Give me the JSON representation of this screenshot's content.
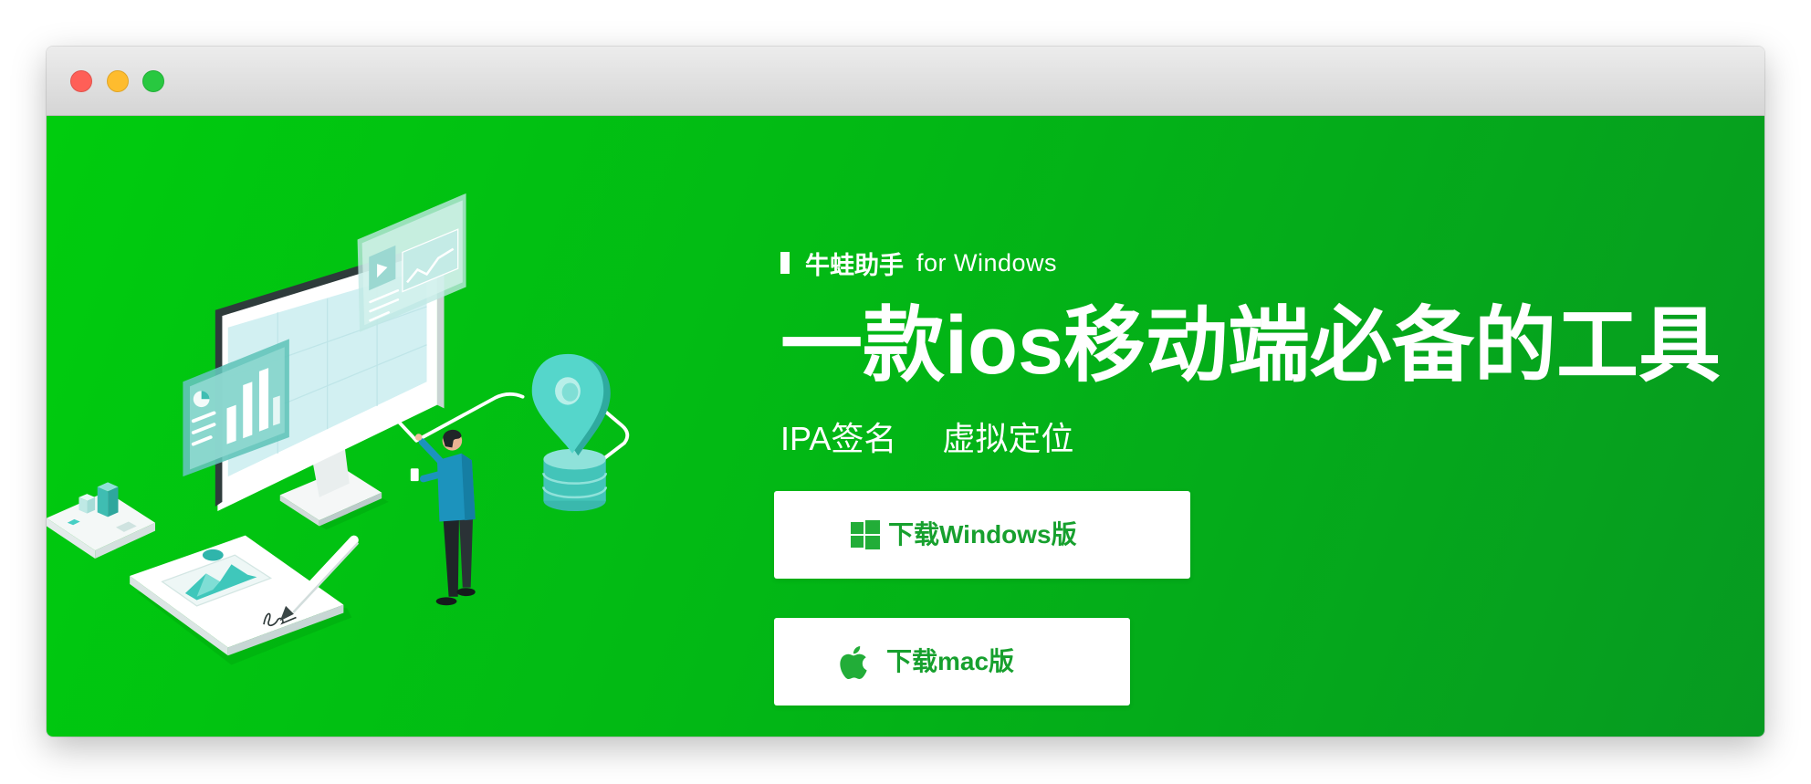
{
  "window": {
    "controls": {
      "close": "#ff5f57",
      "minimize": "#febc2e",
      "zoom": "#28c840"
    }
  },
  "hero": {
    "product_name": "牛蛙助手",
    "platform": "for Windows",
    "headline": "一款ios移动端必备的工具",
    "features": [
      "IPA签名",
      "虚拟定位"
    ],
    "buttons": [
      {
        "label": "下载Windows版",
        "icon": "windows-icon"
      },
      {
        "label": "下载mac版",
        "icon": "apple-icon"
      }
    ]
  },
  "colors": {
    "banner_gradient": [
      "#00cc0e",
      "#02b815",
      "#079a21"
    ],
    "button_text": "#17a02e",
    "button_icon": "#22ad38",
    "accent_teal": "#46cfc4"
  }
}
